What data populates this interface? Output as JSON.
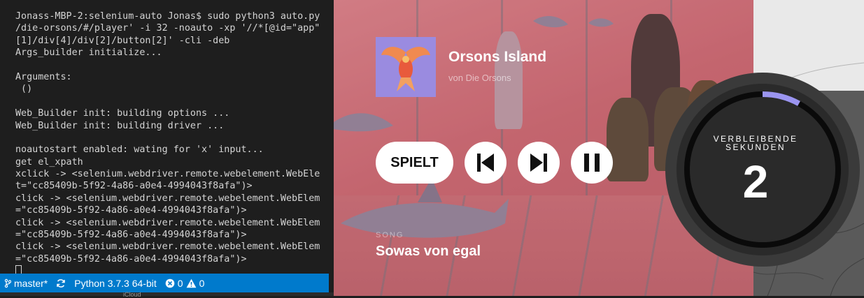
{
  "terminal": {
    "lines": [
      "Jonass-MBP-2:selenium-auto Jonas$ sudo python3 auto.py",
      "/die-orsons/#/player' -i 32 -noauto -xp '//*[@id=\"app\"",
      "[1]/div[4]/div[2]/button[2]' -cli -deb",
      "Args_builder initialize...",
      "",
      "Arguments:",
      " ()",
      "",
      "Web_Builder init: building options ...",
      "Web_Builder init: building driver ...",
      "",
      "noautostart enabled: wating for 'x' input...",
      "get el_xpath",
      "xclick -> <selenium.webdriver.remote.webelement.WebEle",
      "t=\"cc85409b-5f92-4a86-a0e4-4994043f8afa\")>",
      "click -> <selenium.webdriver.remote.webelement.WebElem",
      "=\"cc85409b-5f92-4a86-a0e4-4994043f8afa\")>",
      "click -> <selenium.webdriver.remote.webelement.WebElem",
      "=\"cc85409b-5f92-4a86-a0e4-4994043f8afa\")>",
      "click -> <selenium.webdriver.remote.webelement.WebElem",
      "=\"cc85409b-5f92-4a86-a0e4-4994043f8afa\")>"
    ]
  },
  "statusbar": {
    "branch": "master*",
    "python": "Python 3.7.3 64-bit",
    "errors": "0",
    "warnings": "0"
  },
  "bottom_strip": {
    "label": "iCloud"
  },
  "player": {
    "album_title": "Orsons Island",
    "artist": "von Die Orsons",
    "playing_label": "SPIELT",
    "song_label": "SONG",
    "song_title": "Sowas von egal"
  },
  "countdown": {
    "label_line1": "VERBLEIBENDE",
    "label_line2": "SEKUNDEN",
    "seconds": "2",
    "progress": 0.08,
    "accent_color": "#9b95f0"
  },
  "colors": {
    "statusbar": "#007acc",
    "terminal_bg": "#1e1e1e"
  }
}
